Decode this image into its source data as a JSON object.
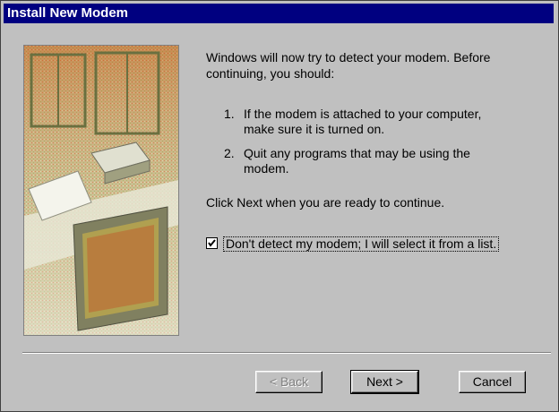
{
  "window": {
    "title": "Install New Modem"
  },
  "content": {
    "intro": "Windows will now try to detect your modem.  Before continuing, you should:",
    "steps": [
      {
        "num": "1.",
        "text": "If the modem is attached to your computer, make sure it is turned on."
      },
      {
        "num": "2.",
        "text": "Quit any programs that may be using the modem."
      }
    ],
    "continue_text": "Click Next when you are ready to continue.",
    "checkbox": {
      "label": "Don't detect my modem; I will select it from a list.",
      "checked": true
    }
  },
  "buttons": {
    "back": "< Back",
    "next": "Next >",
    "cancel": "Cancel"
  },
  "colors": {
    "titlebar": "#000080",
    "dialog": "#c0c0c0"
  }
}
